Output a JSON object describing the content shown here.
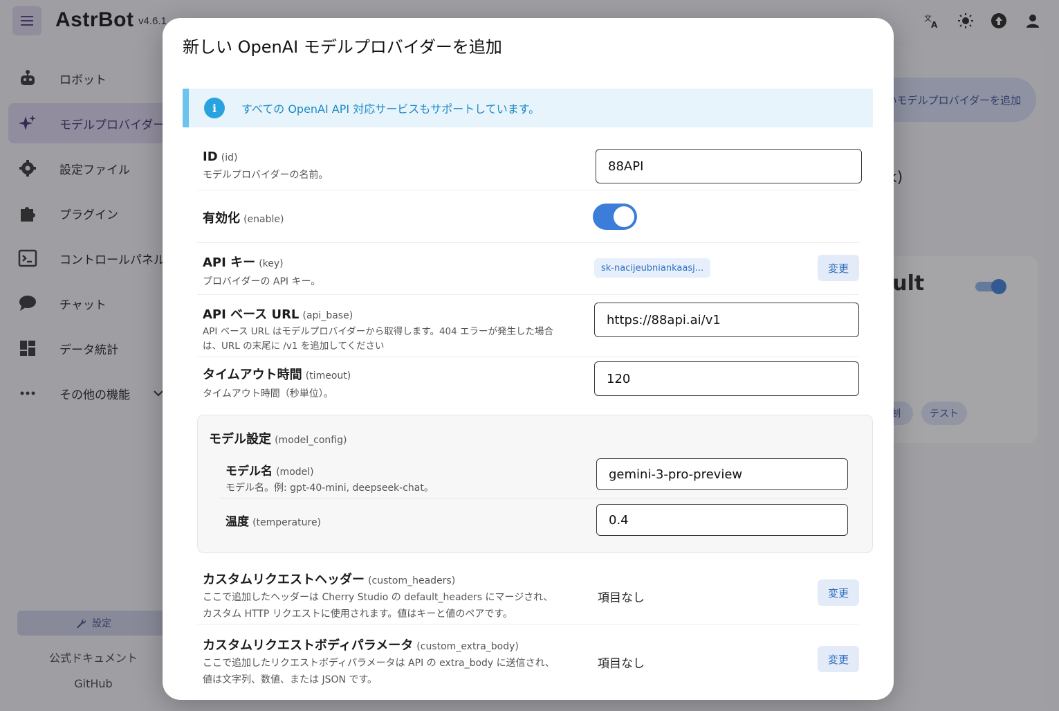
{
  "app": {
    "brand": "AstrBot",
    "version": "v4.6.1"
  },
  "sidebar": {
    "items": [
      {
        "label": "ロボット",
        "icon": "robot-icon"
      },
      {
        "label": "モデルプロバイダー",
        "icon": "sparkle-icon"
      },
      {
        "label": "設定ファイル",
        "icon": "gear-icon"
      },
      {
        "label": "プラグイン",
        "icon": "puzzle-icon"
      },
      {
        "label": "コントロールパネル",
        "icon": "terminal-icon"
      },
      {
        "label": "チャット",
        "icon": "chat-bubble-icon"
      },
      {
        "label": "データ統計",
        "icon": "dashboard-icon"
      },
      {
        "label": "その他の機能",
        "icon": "more-icon"
      }
    ],
    "settings_label": "設定",
    "docs_label": "公式ドキュメント",
    "github_label": "GitHub"
  },
  "background": {
    "add_provider_label": "新しいモデルプロバイダーを追加",
    "fragment_nk": "nk)",
    "fragment_ault": "ault",
    "chip_partial": "制",
    "chip_test": "テスト"
  },
  "dialog": {
    "title": "新しい OpenAI モデルプロバイダーを追加",
    "alert": "すべての OpenAI API 対応サービスもサポートしています。",
    "fields": {
      "id": {
        "label": "ID",
        "key": "(id)",
        "desc": "モデルプロバイダーの名前。",
        "value": "88API"
      },
      "enable": {
        "label": "有効化",
        "key": "(enable)",
        "value": true
      },
      "api_key": {
        "label": "API キー",
        "key": "(key)",
        "desc": "プロバイダーの API キー。",
        "chip": "sk-nacijeubniankaasj...",
        "button": "変更"
      },
      "api_base": {
        "label": "API ベース URL",
        "key": "(api_base)",
        "desc1": "API ベース URL はモデルプロバイダーから取得します。404 エラーが発生した場合",
        "desc2": "は、URL の末尾に /v1 を追加してください",
        "value": "https://88api.ai/v1"
      },
      "timeout": {
        "label": "タイムアウト時間",
        "key": "(timeout)",
        "desc": "タイムアウト時間（秒単位）。",
        "value": "120"
      },
      "model_config": {
        "label": "モデル設定",
        "key": "(model_config)",
        "model": {
          "label": "モデル名",
          "key": "(model)",
          "desc": "モデル名。例: gpt-40-mini, deepseek-chat。",
          "value": "gemini-3-pro-preview"
        },
        "temperature": {
          "label": "温度",
          "key": "(temperature)",
          "value": "0.4"
        }
      },
      "custom_headers": {
        "label": "カスタムリクエストヘッダー",
        "key": "(custom_headers)",
        "desc1": "ここで追加したヘッダーは Cherry Studio の default_headers にマージされ、",
        "desc2": "カスタム HTTP リクエストに使用されます。値はキーと値のペアです。",
        "value": "項目なし",
        "button": "変更"
      },
      "custom_extra_body": {
        "label": "カスタムリクエストボディパラメータ",
        "key": "(custom_extra_body)",
        "desc1": "ここで追加したリクエストボディパラメータは API の extra_body に送信され、",
        "desc2": "値は文字列、数値、または JSON です。",
        "value": "項目なし",
        "button": "変更"
      }
    }
  },
  "colors": {
    "accent": "#3b7dd8",
    "alert_bg": "#e7f4fb",
    "alert_text": "#1d8ac8",
    "sidebar_active": "#dcd6ee"
  }
}
